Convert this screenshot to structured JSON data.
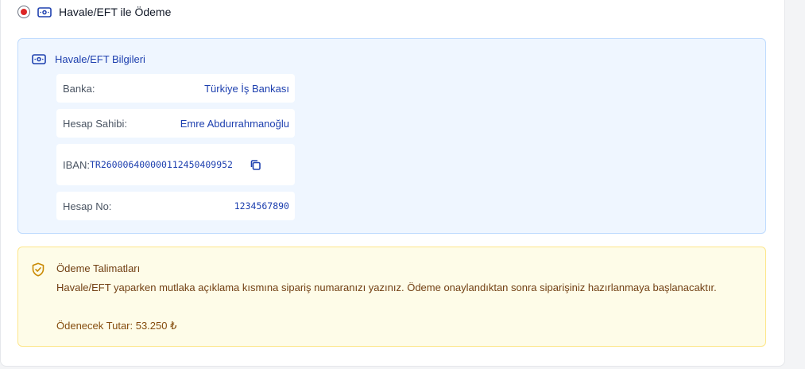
{
  "payment_option": {
    "label": "Havale/EFT ile Ödeme",
    "selected": true,
    "icon": "money-icon"
  },
  "bank_info": {
    "title": "Havale/EFT Bilgileri",
    "icon": "money-icon",
    "bank_label": "Banka:",
    "bank_value": "Türkiye İş Bankası",
    "owner_label": "Hesap Sahibi:",
    "owner_value": "Emre Abdurrahmanoğlu",
    "iban_label": "IBAN:",
    "iban_value": "TR260006400000112450409952",
    "copy_icon": "copy-icon",
    "account_label": "Hesap No:",
    "account_value": "1234567890"
  },
  "instructions": {
    "icon": "shield-check-icon",
    "title": "Ödeme Talimatları",
    "text": "Havale/EFT yaparken mutlaka açıklama kısmına sipariş numaranızı yazınız. Ödeme onaylandıktan sonra siparişiniz hazırlanmaya başlanacaktır.",
    "amount": "Ödenecek Tutar: 53.250 ₺"
  },
  "colors": {
    "accent_blue": "#1e40af",
    "radio_selected": "#dc2626",
    "info_bg": "#eff6ff",
    "notice_bg": "#fefce8",
    "notice_text": "#713f12"
  }
}
